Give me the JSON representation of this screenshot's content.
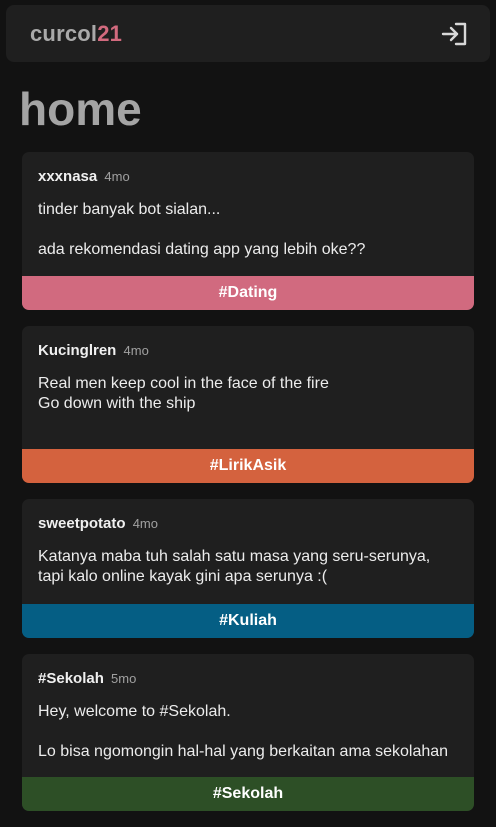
{
  "app": {
    "logo_main": "curcol",
    "logo_accent": "21",
    "logout_icon": "logout-icon"
  },
  "page": {
    "title": "home"
  },
  "colors": {
    "dating": "#d16a7f",
    "lirikasik": "#d4623e",
    "kuliah": "#055e84",
    "sekolah": "#2d4f26"
  },
  "posts": [
    {
      "author": "xxxnasa",
      "time": "4mo",
      "lines": [
        "tinder banyak bot sialan...",
        "ada rekomendasi dating app yang lebih oke??"
      ],
      "tag": "#Dating"
    },
    {
      "author": "Kucinglren",
      "time": "4mo",
      "lines": [
        "Real men keep cool in the face of the fire",
        "Go down with the ship"
      ],
      "tag": "#LirikAsik"
    },
    {
      "author": "sweetpotato",
      "time": "4mo",
      "lines": [
        "Katanya maba tuh salah satu masa yang seru-serunya,",
        "tapi kalo online kayak gini apa serunya :("
      ],
      "tag": "#Kuliah"
    },
    {
      "author": "#Sekolah",
      "time": "5mo",
      "lines": [
        "Hey, welcome to #Sekolah.",
        "Lo bisa ngomongin hal-hal yang berkaitan ama sekolahan"
      ],
      "tag": "#Sekolah"
    }
  ]
}
